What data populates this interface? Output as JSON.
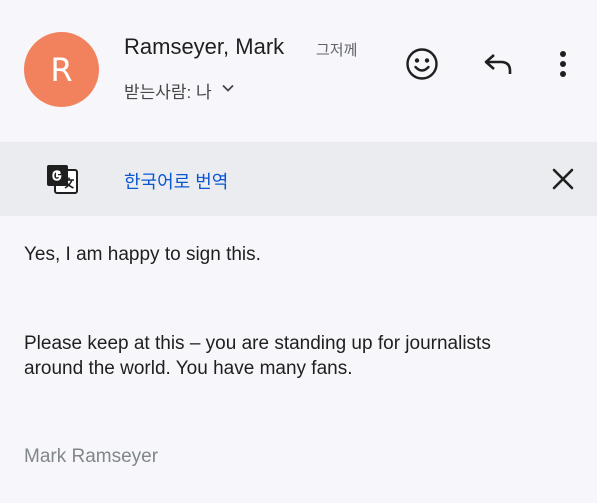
{
  "message": {
    "avatar_initial": "R",
    "avatar_color": "#f2825e",
    "sender_name": "Ramseyer, Mark",
    "time": "그저께",
    "recipient": "받는사람: 나",
    "icons": {
      "emoji": "smiley-icon",
      "reply": "reply-icon",
      "more": "more-vert-icon",
      "recipient_expand": "chevron-down-icon"
    }
  },
  "translate_bar": {
    "label": "한국어로 번역",
    "icons": {
      "translate": "translate-icon",
      "close": "close-icon"
    },
    "link_color": "#0b57d0"
  },
  "body": {
    "line1": "Yes, I am happy to sign this.",
    "para2_line1": "Please keep at this – you are standing up for journalists",
    "para2_line2": "around the world.  You have many fans.",
    "signature": "Mark Ramseyer"
  }
}
